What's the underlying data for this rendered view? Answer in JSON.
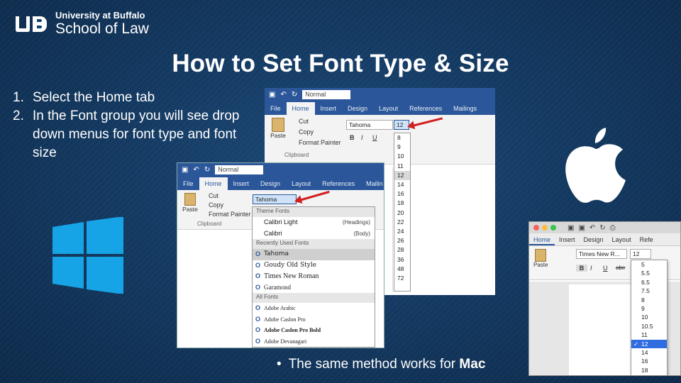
{
  "logo": {
    "line1": "University at Buffalo",
    "line2": "School of Law"
  },
  "title": "How to Set Font Type & Size",
  "steps": [
    {
      "num": "1.",
      "text": "Select the Home tab"
    },
    {
      "num": "2.",
      "text": "In the Font group you will see drop down menus for font type and font size"
    }
  ],
  "footer": {
    "bullet": "•",
    "text": "The same method works for ",
    "emphasis": "Mac"
  },
  "colors": {
    "ribbon_blue": "#2b579a",
    "arrow_red": "#d21f1f",
    "windows_blue": "#16a4e6"
  },
  "word_right": {
    "style_value": "Normal",
    "tabs": [
      "File",
      "Home",
      "Insert",
      "Design",
      "Layout",
      "References",
      "Mailings"
    ],
    "clipboard": [
      "Cut",
      "Copy",
      "Format Painter"
    ],
    "paste": "Paste",
    "clipboard_label": "Clipboard",
    "font_value": "Tahoma",
    "size_value": "12",
    "format_buttons": [
      "B",
      "I",
      "U"
    ],
    "sizes": [
      "8",
      "9",
      "10",
      "11",
      "12",
      "14",
      "16",
      "18",
      "20",
      "22",
      "24",
      "26",
      "28",
      "36",
      "48",
      "72"
    ],
    "selected_size": "12"
  },
  "word_left": {
    "style_value": "Normal",
    "tabs": [
      "File",
      "Home",
      "Insert",
      "Design",
      "Layout",
      "References",
      "Mailin"
    ],
    "clipboard": [
      "Cut",
      "Copy",
      "Format Painter"
    ],
    "paste": "Paste",
    "clipboard_label": "Clipboard",
    "font_value": "Tahoma",
    "format_buttons": [
      "B",
      "I",
      "U"
    ],
    "font_menu": {
      "theme_header": "Theme Fonts",
      "theme_fonts": [
        {
          "name": "Calibri Light",
          "role": "(Headings)"
        },
        {
          "name": "Calibri",
          "role": "(Body)"
        }
      ],
      "recent_header": "Recently Used Fonts",
      "recent_fonts": [
        "Tahoma",
        "Goudy Old Style",
        "Times New Roman",
        "Garamond"
      ],
      "all_header": "All Fonts",
      "all_fonts": [
        "Adobe Arabic",
        "Adobe Caslon Pro",
        "Adobe Caslon Pro Bold",
        "Adobe Devanagari"
      ],
      "selected_font": "Tahoma"
    }
  },
  "word_mac": {
    "tabs": [
      "Home",
      "Insert",
      "Design",
      "Layout",
      "Refe"
    ],
    "font_value": "Times New R...",
    "size_value": "12",
    "paste": "Paste",
    "format_buttons": [
      "B",
      "I",
      "U",
      "abe"
    ],
    "sizes": [
      "5",
      "5.5",
      "6.5",
      "7.5",
      "8",
      "9",
      "10",
      "10.5",
      "11",
      "12",
      "14",
      "16",
      "18"
    ],
    "selected_size": "12",
    "check": "✓"
  }
}
